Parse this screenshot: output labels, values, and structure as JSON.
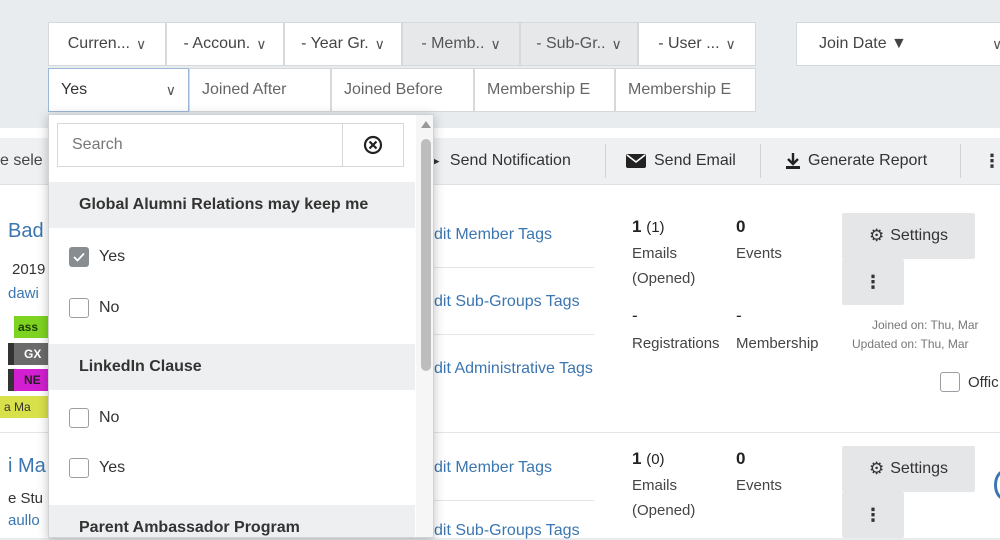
{
  "filters_row1": [
    {
      "label": "Curren...",
      "chev": "∨"
    },
    {
      "label": "- Accoun.",
      "chev": "∨"
    },
    {
      "label": "- Year Gr.",
      "chev": "∨"
    },
    {
      "label": "- Memb..",
      "chev": "∨"
    },
    {
      "label": "- Sub-Gr..",
      "chev": "∨"
    },
    {
      "label": "- User ...",
      "chev": "∨"
    }
  ],
  "sort": {
    "label": "Join Date ▼",
    "chev": "∨"
  },
  "filters_row2": {
    "selected": "Yes",
    "chev": "∨",
    "joined_after": "Joined After",
    "joined_before": "Joined Before",
    "membership_e1": "Membership E",
    "membership_e2": "Membership E"
  },
  "toolbar": {
    "left_fragment": "e sele",
    "send_notification": "Send Notification",
    "send_email": "Send Email",
    "generate_report": "Generate Report",
    "more": "⋮"
  },
  "dropdown": {
    "search_placeholder": "Search",
    "groups": [
      {
        "title": "Global Alumni Relations may keep me",
        "options": [
          {
            "label": "Yes",
            "checked": true
          },
          {
            "label": "No",
            "checked": false
          }
        ]
      },
      {
        "title": "LinkedIn Clause",
        "options": [
          {
            "label": "No",
            "checked": false
          },
          {
            "label": "Yes",
            "checked": false
          }
        ]
      },
      {
        "title": "Parent Ambassador Program",
        "options": []
      }
    ]
  },
  "rows": [
    {
      "name_frag": "Bad",
      "year_frag": "2019",
      "email_frag": "dawi",
      "tags": [
        {
          "text": "ass",
          "bg": "#7ed321",
          "fg": "#1a3d00"
        },
        {
          "text": "GX",
          "bg": "#6b6b6b",
          "fg": "#ffffff"
        },
        {
          "text": "NE",
          "bg": "#d21fd1",
          "fg": "#222222"
        },
        {
          "text": "a Ma",
          "bg": "#d9e14a",
          "fg": "#333333"
        }
      ],
      "links": [
        "dit Member Tags",
        "dit Sub-Groups Tags",
        "dit Administrative Tags"
      ],
      "emails_num": "1",
      "emails_paren": "(1)",
      "emails_label": "Emails",
      "emails_sub": "(Opened)",
      "events_num": "0",
      "events_label": "Events",
      "reg_num": "-",
      "reg_label": "Registrations",
      "mem_num": "-",
      "mem_label": "Membership",
      "settings": "Settings",
      "joined": "Joined on: Thu, Mar",
      "updated": "Updated on: Thu, Mar",
      "office_frag": "Offic"
    },
    {
      "name_frag": "i Ma",
      "line2_frag": "e Stu",
      "line3_frag": "aullo",
      "links": [
        "dit Member Tags",
        "dit Sub-Groups Tags"
      ],
      "emails_num": "1",
      "emails_paren": "(0)",
      "emails_label": "Emails",
      "emails_sub": "(Opened)",
      "events_num": "0",
      "events_label": "Events",
      "settings": "Settings"
    }
  ]
}
